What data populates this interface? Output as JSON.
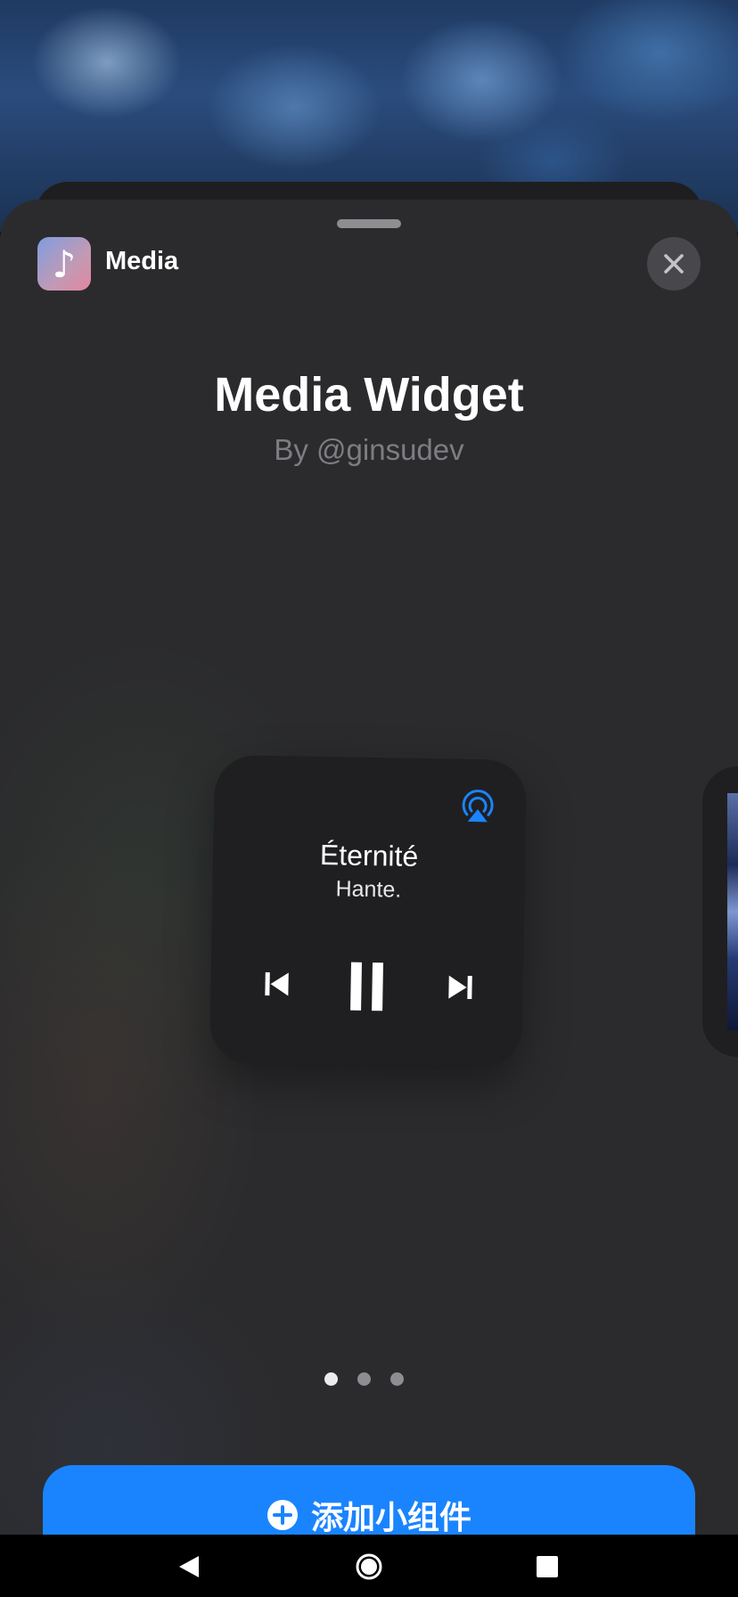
{
  "header": {
    "app_icon": "music-note-icon",
    "app_icon_glyph": "♪",
    "app_name": "Media",
    "close_icon": "close-icon"
  },
  "widget_info": {
    "title": "Media Widget",
    "author": "By @ginsudev"
  },
  "preview": {
    "track_title": "Éternité",
    "track_artist": "Hante.",
    "airplay_icon": "airplay-icon",
    "controls": [
      "previous-track-icon",
      "pause-icon",
      "next-track-icon"
    ]
  },
  "pager": {
    "pages": 3,
    "current": 1
  },
  "add_button": {
    "icon": "plus-circle-icon",
    "label": "添加小组件"
  },
  "system_nav": [
    "back-icon",
    "home-icon",
    "recents-icon"
  ],
  "colors": {
    "accent": "#1a84ff",
    "sheet": "#2b2b2d",
    "widget": "#1f1f21"
  }
}
